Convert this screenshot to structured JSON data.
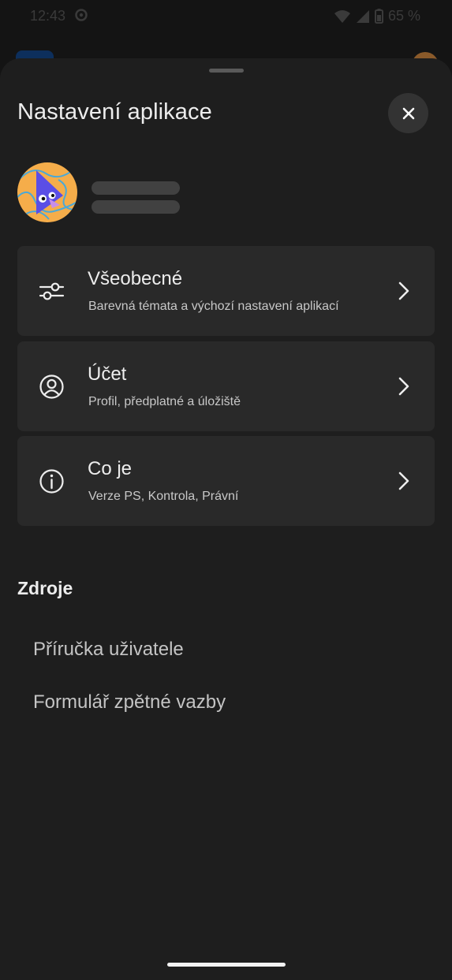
{
  "status_bar": {
    "time": "12:43",
    "battery": "65 %"
  },
  "header": {
    "title": "Nastavení aplikace",
    "close_icon": "close-icon"
  },
  "settings": {
    "items": [
      {
        "title": "Všeobecné",
        "subtitle": "Barevná témata a výchozí nastavení aplikací",
        "icon": "sliders-icon"
      },
      {
        "title": "Účet",
        "subtitle": "Profil, předplatné a úložiště",
        "icon": "account-circle-icon"
      },
      {
        "title": "Co je",
        "subtitle": "Verze PS, Kontrola, Právní",
        "icon": "info-icon"
      }
    ]
  },
  "resources": {
    "heading": "Zdroje",
    "links": [
      "Příručka uživatele",
      "Formulář zpětné vazby"
    ]
  },
  "colors": {
    "sheet_background": "#1e1e1e",
    "card_background": "#292929",
    "close_button_background": "#333333",
    "avatar_background": "#f5ad4a",
    "avatar_character": "#5b4ee6"
  }
}
